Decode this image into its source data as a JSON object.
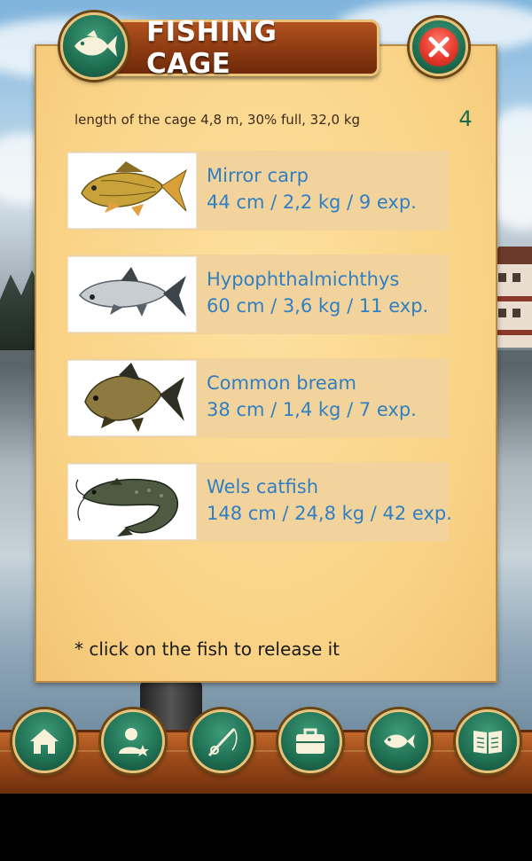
{
  "title": "FISHING CAGE",
  "cage_info": "length of the cage 4,8 m, 30% full, 32,0 kg",
  "fish_count": "4",
  "fish": [
    {
      "name": "Mirror carp",
      "stats": "44 cm / 2,2 kg / 9 exp.",
      "icon": "mirror-carp-image"
    },
    {
      "name": "Hypophthalmichthys",
      "stats": "60 cm / 3,6 kg / 11 exp.",
      "icon": "silver-carp-image"
    },
    {
      "name": "Common bream",
      "stats": "38 cm / 1,4 kg / 7 exp.",
      "icon": "bream-image"
    },
    {
      "name": "Wels catfish",
      "stats": "148 cm / 24,8 kg / 42 exp.",
      "icon": "catfish-image"
    }
  ],
  "hint": "* click on the fish to release it",
  "nav": [
    {
      "icon": "home-icon"
    },
    {
      "icon": "profile-icon"
    },
    {
      "icon": "fishing-rod-icon"
    },
    {
      "icon": "briefcase-icon"
    },
    {
      "icon": "fish-icon"
    },
    {
      "icon": "book-icon"
    }
  ],
  "colors": {
    "panel": "#fbd78a",
    "fish_text": "#2f7fc4",
    "button_green": "#1f6e52",
    "banner_brown": "#8c3a12",
    "close_red": "#e63a2c"
  }
}
